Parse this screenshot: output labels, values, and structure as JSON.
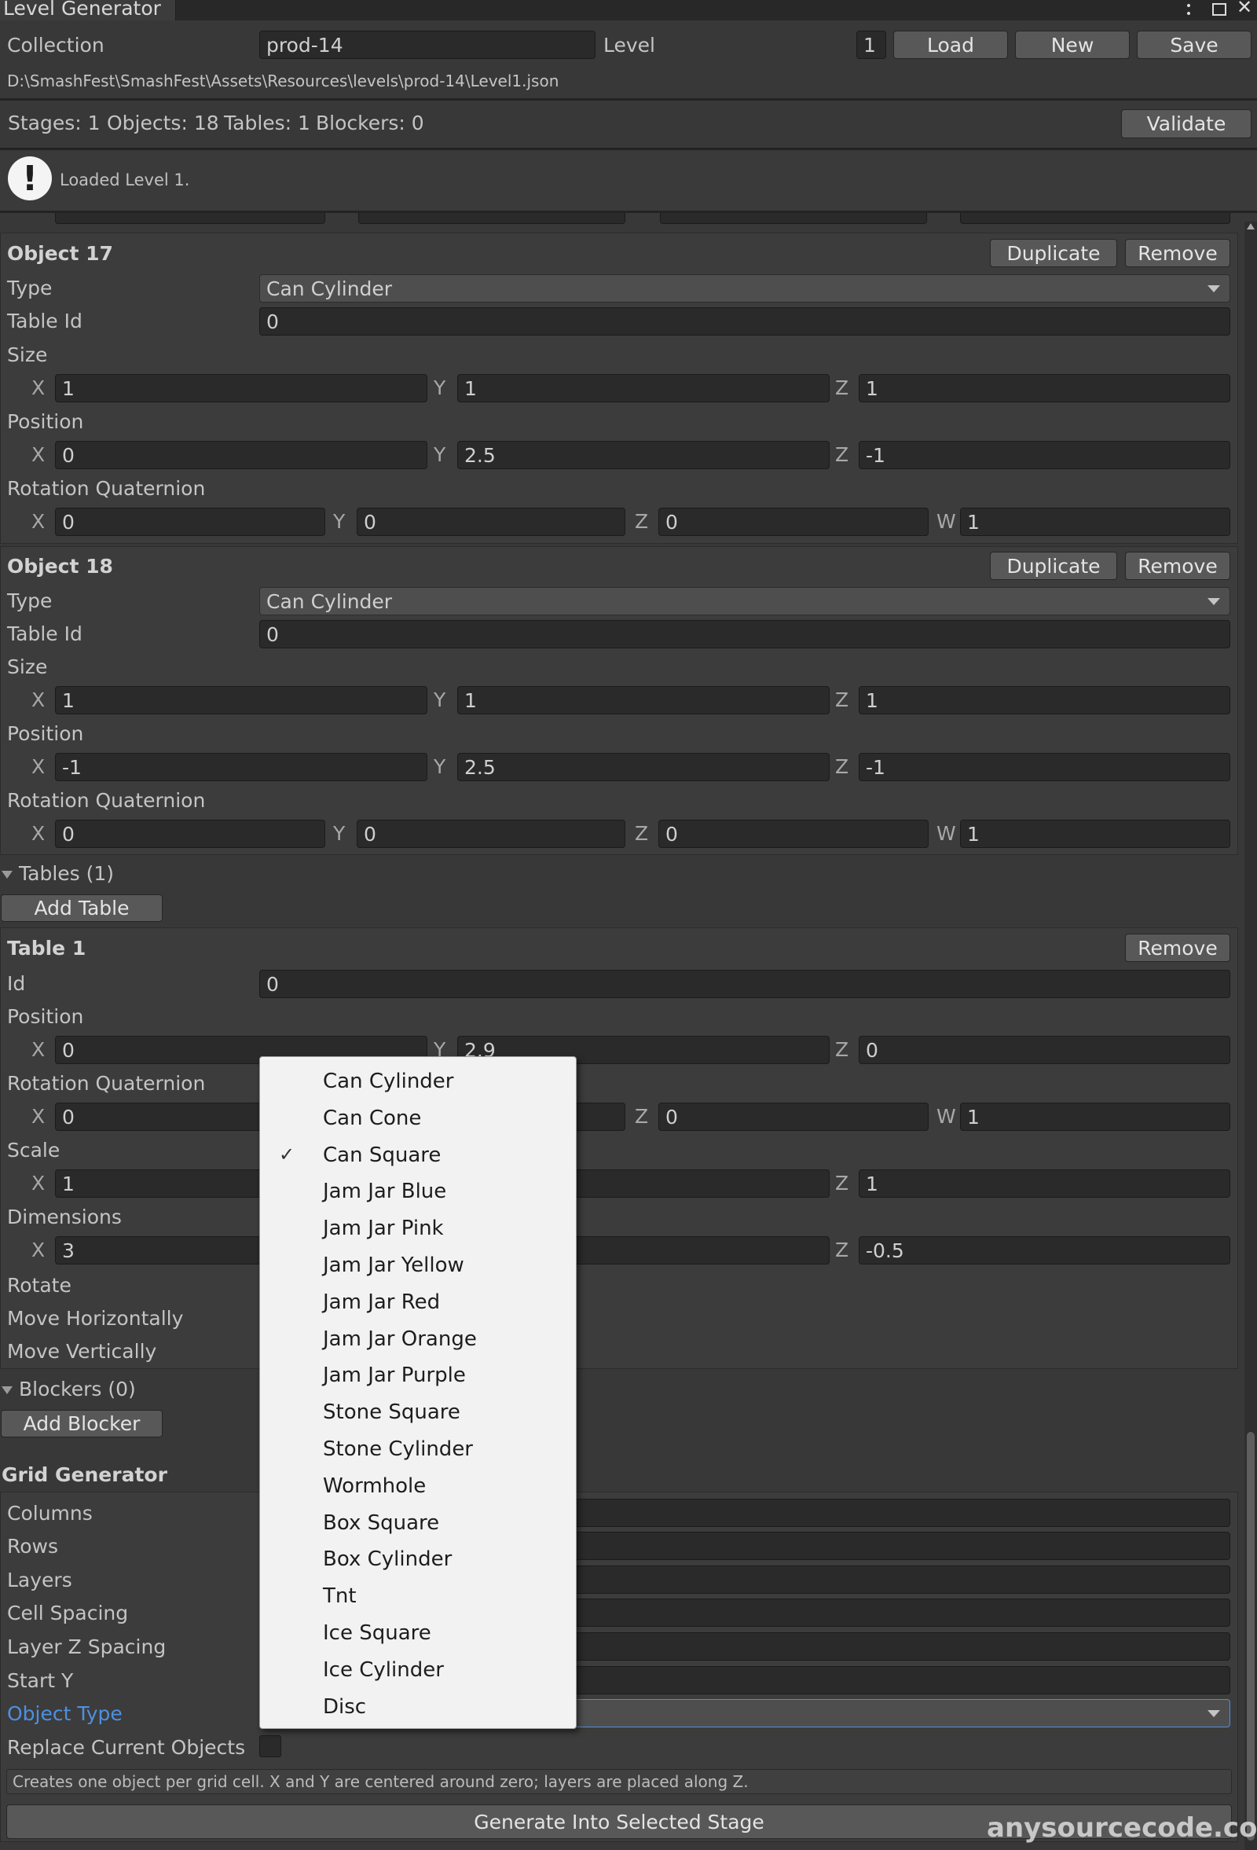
{
  "window": {
    "title": "Level Generator",
    "menu_icon": "kebab-menu-icon",
    "maximize_icon": "maximize-icon",
    "close_icon": "close-icon"
  },
  "header": {
    "collection_label": "Collection",
    "collection_value": "prod-14",
    "level_label": "Level",
    "level_value": "1",
    "load": "Load",
    "new": "New",
    "save": "Save",
    "path": "D:\\SmashFest\\SmashFest\\Assets\\Resources\\levels\\prod-14\\Level1.json"
  },
  "stats": {
    "stages": "Stages: 1",
    "objects": "Objects: 18",
    "tables": "Tables: 1",
    "blockers": "Blockers: 0",
    "validate": "Validate"
  },
  "info": {
    "icon": "info-exclamation-icon",
    "message": "Loaded Level 1."
  },
  "objects": [
    {
      "title": "Object 17",
      "duplicate": "Duplicate",
      "remove": "Remove",
      "type_label": "Type",
      "type_value": "Can Cylinder",
      "table_id_label": "Table Id",
      "table_id_value": "0",
      "size_label": "Size",
      "size": {
        "x": "1",
        "y": "1",
        "z": "1"
      },
      "position_label": "Position",
      "position": {
        "x": "0",
        "y": "2.5",
        "z": "-1"
      },
      "rotation_label": "Rotation Quaternion",
      "rotation": {
        "x": "0",
        "y": "0",
        "z": "0",
        "w": "1"
      }
    },
    {
      "title": "Object 18",
      "duplicate": "Duplicate",
      "remove": "Remove",
      "type_label": "Type",
      "type_value": "Can Cylinder",
      "table_id_label": "Table Id",
      "table_id_value": "0",
      "size_label": "Size",
      "size": {
        "x": "1",
        "y": "1",
        "z": "1"
      },
      "position_label": "Position",
      "position": {
        "x": "-1",
        "y": "2.5",
        "z": "-1"
      },
      "rotation_label": "Rotation Quaternion",
      "rotation": {
        "x": "0",
        "y": "0",
        "z": "0",
        "w": "1"
      }
    }
  ],
  "axes": {
    "x": "X",
    "y": "Y",
    "z": "Z",
    "w": "W"
  },
  "tables_section": {
    "title": "Tables (1)",
    "add": "Add Table"
  },
  "table": {
    "title": "Table 1",
    "remove": "Remove",
    "id_label": "Id",
    "id_value": "0",
    "position_label": "Position",
    "position": {
      "x": "0",
      "y": "2.9",
      "z": "0"
    },
    "rotation_label": "Rotation Quaternion",
    "rotation": {
      "x": "0",
      "z": "0",
      "w": "1"
    },
    "scale_label": "Scale",
    "scale": {
      "x": "1",
      "z": "1"
    },
    "dimensions_label": "Dimensions",
    "dimensions": {
      "x": "3",
      "z": "-0.5"
    },
    "rotate_label": "Rotate",
    "move_h_label": "Move Horizontally",
    "move_v_label": "Move Vertically"
  },
  "blockers_section": {
    "title": "Blockers (0)",
    "add": "Add Blocker"
  },
  "grid": {
    "title": "Grid Generator",
    "columns": "Columns",
    "rows": "Rows",
    "layers": "Layers",
    "cell_spacing": "Cell Spacing",
    "layer_z_spacing": "Layer Z Spacing",
    "start_y": "Start Y",
    "object_type": "Object Type",
    "replace": "Replace Current Objects",
    "help": "Creates one object per grid cell. X and Y are centered around zero; layers are placed along Z.",
    "generate": "Generate Into Selected Stage"
  },
  "dropdown": {
    "selected": "Can Square",
    "options": [
      "Can Cylinder",
      "Can Cone",
      "Can Square",
      "Jam Jar Blue",
      "Jam Jar Pink",
      "Jam Jar Yellow",
      "Jam Jar Red",
      "Jam Jar Orange",
      "Jam Jar Purple",
      "Stone Square",
      "Stone Cylinder",
      "Wormhole",
      "Box Square",
      "Box Cylinder",
      "Tnt",
      "Ice Square",
      "Ice Cylinder",
      "Disc"
    ]
  },
  "watermark": "anysourcecode.com",
  "colors": {
    "background": "#383838",
    "field": "#2a2a2a",
    "button": "#585858",
    "accent_blue": "#4d90e0",
    "popup": "#f2f2f2"
  }
}
